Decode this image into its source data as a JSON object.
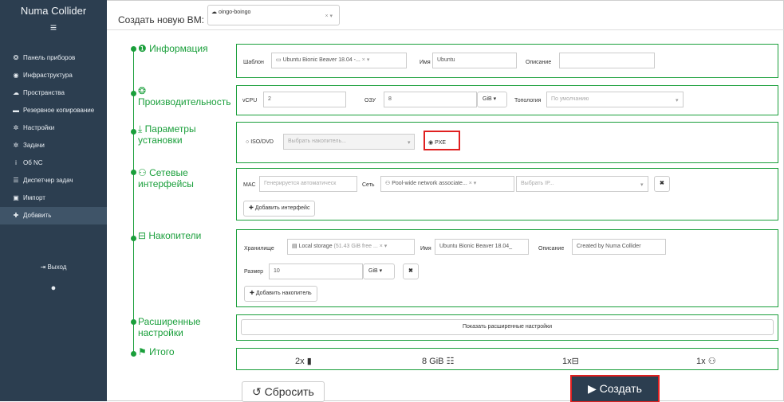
{
  "sidebar": {
    "brand": "Numa Collider",
    "items": [
      {
        "icon": "dashboard-icon",
        "glyph": "❂",
        "label": "Панель приборов"
      },
      {
        "icon": "globe-icon",
        "glyph": "◉",
        "label": "Инфраструктура"
      },
      {
        "icon": "cloud-icon",
        "glyph": "☁",
        "label": "Пространства"
      },
      {
        "icon": "archive-icon",
        "glyph": "▬",
        "label": "Резервное копирование"
      },
      {
        "icon": "gear-icon",
        "glyph": "✲",
        "label": "Настройки"
      },
      {
        "icon": "gears-icon",
        "glyph": "✲",
        "label": "Задачи"
      },
      {
        "icon": "info-icon",
        "glyph": "i",
        "label": "Об NC"
      },
      {
        "icon": "tasks-icon",
        "glyph": "☰",
        "label": "Диспетчер задач"
      },
      {
        "icon": "import-icon",
        "glyph": "▣",
        "label": "Импорт"
      },
      {
        "icon": "plus-icon",
        "glyph": "✚",
        "label": "Добавить"
      }
    ],
    "logout": "Выход"
  },
  "header": {
    "label": "Создать новую ВМ:",
    "pool": "oingo-boingo"
  },
  "info": {
    "title": "Информация",
    "template_label": "Шаблон",
    "template_value": "Ubuntu Bionic Beaver 18.04 -...",
    "name_label": "Имя",
    "name_value": "Ubuntu",
    "desc_label": "Описание",
    "desc_value": ""
  },
  "performance": {
    "title": "Производительность",
    "vcpu_label": "vCPU",
    "vcpu_value": "2",
    "ram_label": "ОЗУ",
    "ram_value": "8",
    "ram_unit": "GiB",
    "topology_label": "Топология",
    "topology_placeholder": "По умолчанию"
  },
  "install": {
    "title_1": "Параметры",
    "title_2": "установки",
    "iso_label": "ISO/DVD",
    "iso_placeholder": "Выбрать накопитель...",
    "pxe_label": "PXE",
    "selected": "PXE"
  },
  "network": {
    "title_1": "Сетевые",
    "title_2": "интерфейсы",
    "mac_label": "MAC",
    "mac_placeholder": "Генерируется автоматическ",
    "net_label": "Сеть",
    "net_value": "Pool-wide network associate...",
    "ip_placeholder": "Выбрать IP...",
    "add_label": "Добавить интерфейс"
  },
  "storage": {
    "title": "Накопители",
    "sr_label": "Хранилище",
    "sr_value": "Local storage",
    "sr_free": "(51.43 GiB free ...",
    "name_label": "Имя",
    "name_value": "Ubuntu Bionic Beaver 18.04_",
    "desc_label": "Описание",
    "desc_value": "Created by Numa Collider",
    "size_label": "Размер",
    "size_value": "10",
    "size_unit": "GiB",
    "add_label": "Добавить накопитель"
  },
  "advanced": {
    "title_1": "Расширенные",
    "title_2": "настройки",
    "button": "Показать расширенные настройки"
  },
  "summary": {
    "title": "Итого",
    "cpu": "2x",
    "ram": "8 GiB",
    "disks": "1x",
    "networks": "1x"
  },
  "actions": {
    "reset": "Сбросить",
    "create": "Создать"
  },
  "colors": {
    "accent": "#1a9f3b",
    "sidebar": "#2c3e50",
    "highlight": "#e02020"
  }
}
